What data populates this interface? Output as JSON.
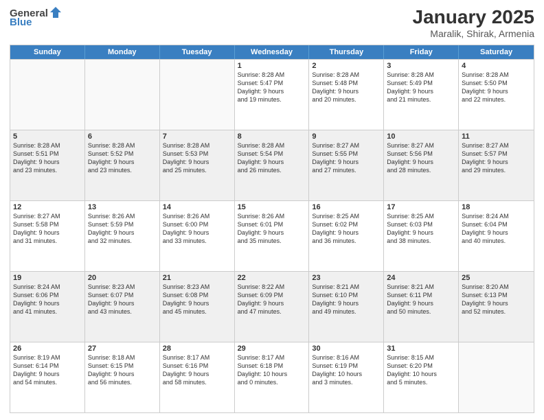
{
  "logo": {
    "general": "General",
    "blue": "Blue"
  },
  "title": "January 2025",
  "subtitle": "Maralik, Shirak, Armenia",
  "days": [
    "Sunday",
    "Monday",
    "Tuesday",
    "Wednesday",
    "Thursday",
    "Friday",
    "Saturday"
  ],
  "weeks": [
    [
      {
        "day": "",
        "info": ""
      },
      {
        "day": "",
        "info": ""
      },
      {
        "day": "",
        "info": ""
      },
      {
        "day": "1",
        "info": "Sunrise: 8:28 AM\nSunset: 5:47 PM\nDaylight: 9 hours\nand 19 minutes."
      },
      {
        "day": "2",
        "info": "Sunrise: 8:28 AM\nSunset: 5:48 PM\nDaylight: 9 hours\nand 20 minutes."
      },
      {
        "day": "3",
        "info": "Sunrise: 8:28 AM\nSunset: 5:49 PM\nDaylight: 9 hours\nand 21 minutes."
      },
      {
        "day": "4",
        "info": "Sunrise: 8:28 AM\nSunset: 5:50 PM\nDaylight: 9 hours\nand 22 minutes."
      }
    ],
    [
      {
        "day": "5",
        "info": "Sunrise: 8:28 AM\nSunset: 5:51 PM\nDaylight: 9 hours\nand 23 minutes."
      },
      {
        "day": "6",
        "info": "Sunrise: 8:28 AM\nSunset: 5:52 PM\nDaylight: 9 hours\nand 23 minutes."
      },
      {
        "day": "7",
        "info": "Sunrise: 8:28 AM\nSunset: 5:53 PM\nDaylight: 9 hours\nand 25 minutes."
      },
      {
        "day": "8",
        "info": "Sunrise: 8:28 AM\nSunset: 5:54 PM\nDaylight: 9 hours\nand 26 minutes."
      },
      {
        "day": "9",
        "info": "Sunrise: 8:27 AM\nSunset: 5:55 PM\nDaylight: 9 hours\nand 27 minutes."
      },
      {
        "day": "10",
        "info": "Sunrise: 8:27 AM\nSunset: 5:56 PM\nDaylight: 9 hours\nand 28 minutes."
      },
      {
        "day": "11",
        "info": "Sunrise: 8:27 AM\nSunset: 5:57 PM\nDaylight: 9 hours\nand 29 minutes."
      }
    ],
    [
      {
        "day": "12",
        "info": "Sunrise: 8:27 AM\nSunset: 5:58 PM\nDaylight: 9 hours\nand 31 minutes."
      },
      {
        "day": "13",
        "info": "Sunrise: 8:26 AM\nSunset: 5:59 PM\nDaylight: 9 hours\nand 32 minutes."
      },
      {
        "day": "14",
        "info": "Sunrise: 8:26 AM\nSunset: 6:00 PM\nDaylight: 9 hours\nand 33 minutes."
      },
      {
        "day": "15",
        "info": "Sunrise: 8:26 AM\nSunset: 6:01 PM\nDaylight: 9 hours\nand 35 minutes."
      },
      {
        "day": "16",
        "info": "Sunrise: 8:25 AM\nSunset: 6:02 PM\nDaylight: 9 hours\nand 36 minutes."
      },
      {
        "day": "17",
        "info": "Sunrise: 8:25 AM\nSunset: 6:03 PM\nDaylight: 9 hours\nand 38 minutes."
      },
      {
        "day": "18",
        "info": "Sunrise: 8:24 AM\nSunset: 6:04 PM\nDaylight: 9 hours\nand 40 minutes."
      }
    ],
    [
      {
        "day": "19",
        "info": "Sunrise: 8:24 AM\nSunset: 6:06 PM\nDaylight: 9 hours\nand 41 minutes."
      },
      {
        "day": "20",
        "info": "Sunrise: 8:23 AM\nSunset: 6:07 PM\nDaylight: 9 hours\nand 43 minutes."
      },
      {
        "day": "21",
        "info": "Sunrise: 8:23 AM\nSunset: 6:08 PM\nDaylight: 9 hours\nand 45 minutes."
      },
      {
        "day": "22",
        "info": "Sunrise: 8:22 AM\nSunset: 6:09 PM\nDaylight: 9 hours\nand 47 minutes."
      },
      {
        "day": "23",
        "info": "Sunrise: 8:21 AM\nSunset: 6:10 PM\nDaylight: 9 hours\nand 49 minutes."
      },
      {
        "day": "24",
        "info": "Sunrise: 8:21 AM\nSunset: 6:11 PM\nDaylight: 9 hours\nand 50 minutes."
      },
      {
        "day": "25",
        "info": "Sunrise: 8:20 AM\nSunset: 6:13 PM\nDaylight: 9 hours\nand 52 minutes."
      }
    ],
    [
      {
        "day": "26",
        "info": "Sunrise: 8:19 AM\nSunset: 6:14 PM\nDaylight: 9 hours\nand 54 minutes."
      },
      {
        "day": "27",
        "info": "Sunrise: 8:18 AM\nSunset: 6:15 PM\nDaylight: 9 hours\nand 56 minutes."
      },
      {
        "day": "28",
        "info": "Sunrise: 8:17 AM\nSunset: 6:16 PM\nDaylight: 9 hours\nand 58 minutes."
      },
      {
        "day": "29",
        "info": "Sunrise: 8:17 AM\nSunset: 6:18 PM\nDaylight: 10 hours\nand 0 minutes."
      },
      {
        "day": "30",
        "info": "Sunrise: 8:16 AM\nSunset: 6:19 PM\nDaylight: 10 hours\nand 3 minutes."
      },
      {
        "day": "31",
        "info": "Sunrise: 8:15 AM\nSunset: 6:20 PM\nDaylight: 10 hours\nand 5 minutes."
      },
      {
        "day": "",
        "info": ""
      }
    ]
  ]
}
